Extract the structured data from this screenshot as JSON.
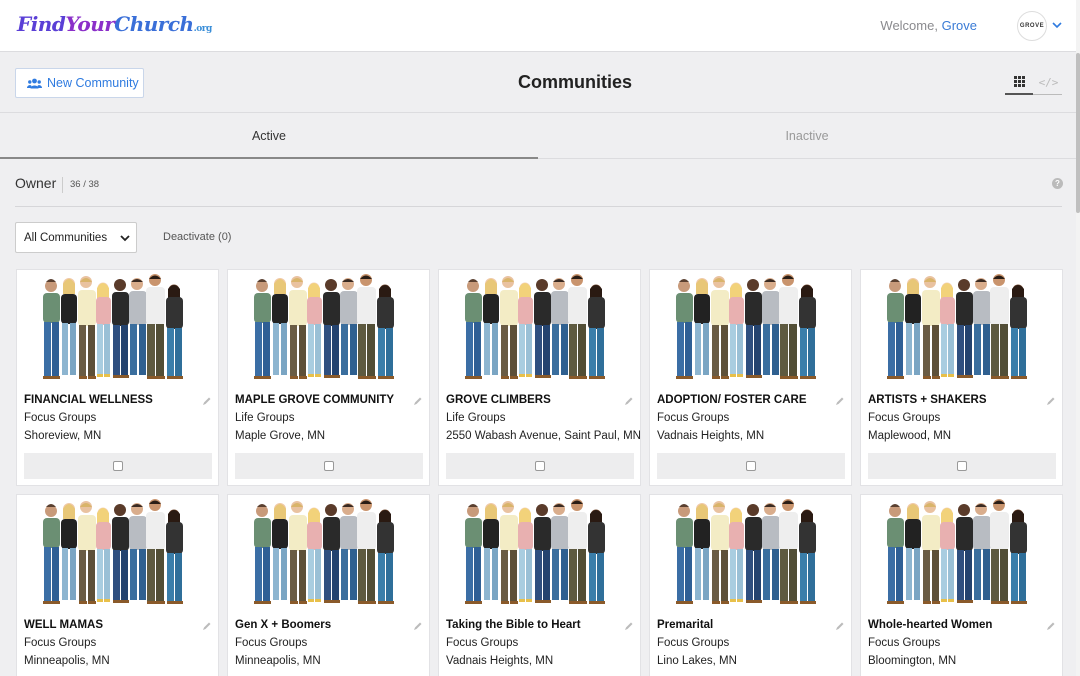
{
  "header": {
    "logo_find": "Find",
    "logo_your": "Your",
    "logo_church": "Church",
    "logo_org": ".org",
    "welcome_prefix": "Welcome,",
    "user_name": "Grove",
    "avatar_text": "GROVE"
  },
  "toolbar": {
    "new_community_label": "New Community",
    "page_title": "Communities",
    "code_toggle": "</>"
  },
  "tabs": [
    {
      "label": "Active",
      "selected": true
    },
    {
      "label": "Inactive",
      "selected": false
    }
  ],
  "owner": {
    "label": "Owner",
    "count": "36 / 38",
    "help": "?"
  },
  "filters": {
    "select_value": "All Communities",
    "deactivate_label": "Deactivate (0)"
  },
  "communities": [
    {
      "name": "FINANCIAL WELLNESS",
      "type": "Focus Groups",
      "location": "Shoreview, MN"
    },
    {
      "name": "MAPLE GROVE COMMUNITY",
      "type": "Life Groups",
      "location": "Maple Grove, MN"
    },
    {
      "name": "GROVE CLIMBERS",
      "type": "Life Groups",
      "location": "2550 Wabash Avenue, Saint Paul, MN"
    },
    {
      "name": "ADOPTION/ FOSTER CARE",
      "type": "Focus Groups",
      "location": "Vadnais Heights, MN"
    },
    {
      "name": "ARTISTS + SHAKERS",
      "type": "Focus Groups",
      "location": "Maplewood, MN"
    },
    {
      "name": "WELL MAMAS",
      "type": "Focus Groups",
      "location": "Minneapolis, MN"
    },
    {
      "name": "Gen X + Boomers",
      "type": "Focus Groups",
      "location": "Minneapolis, MN"
    },
    {
      "name": "Taking the Bible to Heart",
      "type": "Focus Groups",
      "location": "Vadnais Heights, MN"
    },
    {
      "name": "Premarital",
      "type": "Focus Groups",
      "location": "Lino Lakes, MN"
    },
    {
      "name": "Whole-hearted Women",
      "type": "Focus Groups",
      "location": "Bloomington, MN"
    }
  ],
  "colors": {
    "accent": "#2f7be0",
    "logo_purple": "#5a3fd6",
    "background": "#efeff1"
  }
}
